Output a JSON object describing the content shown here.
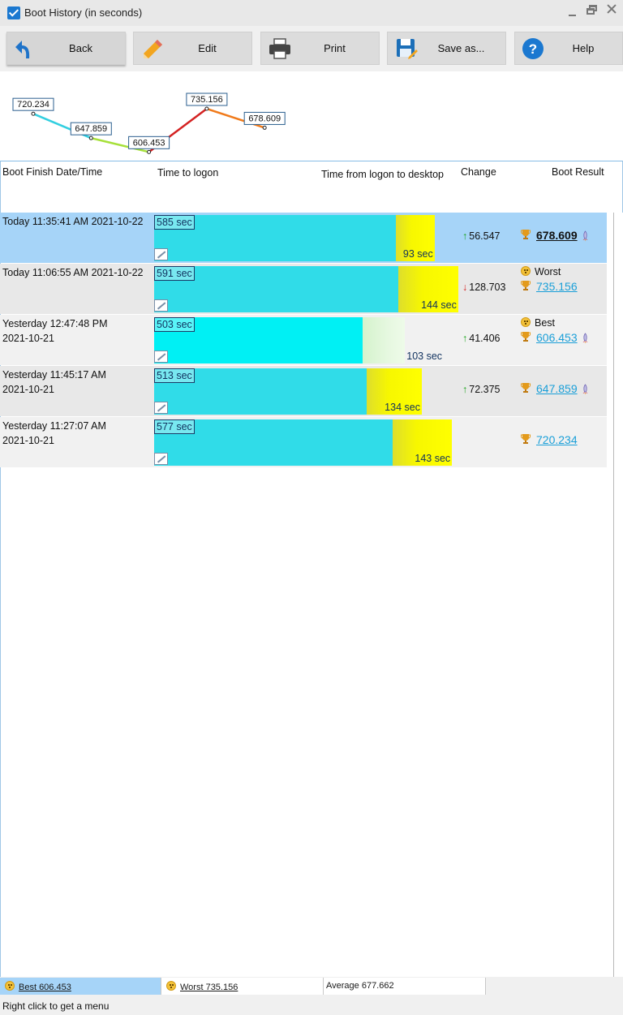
{
  "window": {
    "title": "Boot History (in seconds)"
  },
  "toolbar": {
    "back": "Back",
    "edit": "Edit",
    "print": "Print",
    "save": "Save as...",
    "help": "Help"
  },
  "chart_data": {
    "type": "line",
    "x": [
      "2021-10-21 11:27:07 AM",
      "2021-10-21 11:45:17 AM",
      "2021-10-21 12:47:48 PM",
      "2021-10-22 11:06:55 AM",
      "2021-10-22 11:35:41 AM"
    ],
    "values": [
      720.234,
      647.859,
      606.453,
      735.156,
      678.609
    ],
    "labels": [
      "720.234",
      "647.859",
      "606.453",
      "735.156",
      "678.609"
    ],
    "segment_colors": [
      "#33cfe0",
      "#a6e03a",
      "#d42222",
      "#f07a1a"
    ]
  },
  "headers": {
    "date": "Boot Finish Date/Time",
    "logon": "Time to logon",
    "desktop": "Time from logon to desktop",
    "change": "Change",
    "result": "Boot Result"
  },
  "rows": [
    {
      "date": "Today  11:35:41 AM 2021-10-22",
      "logon_sec": 585,
      "logon_label": "585 sec",
      "desktop_sec": 93,
      "desktop_label": "93 sec",
      "change_dir": "up",
      "change": "56.547",
      "flag": "",
      "result": "678.609",
      "current": true
    },
    {
      "date": "Today  11:06:55 AM 2021-10-22",
      "logon_sec": 591,
      "logon_label": "591 sec",
      "desktop_sec": 144,
      "desktop_label": "144 sec",
      "change_dir": "down",
      "change": "128.703",
      "flag": "Worst",
      "result": "735.156",
      "current": false
    },
    {
      "date": "Yesterday  12:47:48 PM\n2021-10-21",
      "logon_sec": 503,
      "logon_label": "503 sec",
      "desktop_sec": 103,
      "desktop_label": "103 sec",
      "change_dir": "up",
      "change": "41.406",
      "flag": "Best",
      "result": "606.453",
      "current": false
    },
    {
      "date": "Yesterday  11:45:17 AM\n2021-10-21",
      "logon_sec": 513,
      "logon_label": "513 sec",
      "desktop_sec": 134,
      "desktop_label": "134 sec",
      "change_dir": "up",
      "change": "72.375",
      "flag": "",
      "result": "647.859",
      "current": false
    },
    {
      "date": "Yesterday  11:27:07 AM\n2021-10-21",
      "logon_sec": 577,
      "logon_label": "577 sec",
      "desktop_sec": 143,
      "desktop_label": "143 sec",
      "change_dir": "",
      "change": "",
      "flag": "",
      "result": "720.234",
      "current": false
    }
  ],
  "status": {
    "best": "Best 606.453",
    "worst": "Worst 735.156",
    "average": "Average 677.662"
  },
  "hint": "Right click to get a menu"
}
